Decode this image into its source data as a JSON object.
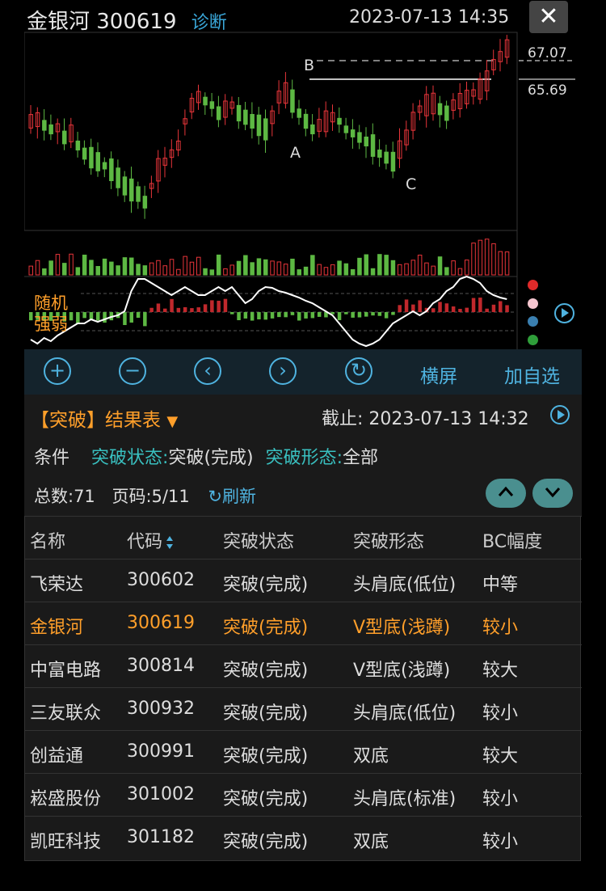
{
  "header": {
    "title": "金银河 300619",
    "diagnose_label": "诊断",
    "datetime": "2023-07-13 14:35",
    "close_icon": "close-icon"
  },
  "price_labels": {
    "top": "67.07",
    "mid": "65.69"
  },
  "pattern_points": {
    "a": "A",
    "b": "B",
    "c": "C"
  },
  "indicator": {
    "label_line1": "随机",
    "label_line2": "强弱"
  },
  "colors": {
    "up": "#e8353a",
    "down": "#5db843",
    "accent": "#4fb3e0",
    "highlight": "#ff9f2a",
    "teal": "#39c0c0",
    "dots": [
      "#e02a2a",
      "#f5c6d0",
      "#3a7fb0",
      "#2f9e3a"
    ]
  },
  "toolbar": {
    "zoom_in_icon": "plus-circle-icon",
    "zoom_out_icon": "minus-circle-icon",
    "prev_icon": "chevron-left-circle-icon",
    "next_icon": "chevron-right-circle-icon",
    "refresh_icon": "refresh-circle-icon",
    "landscape_label": "横屏",
    "add_watch_label": "加自选"
  },
  "result": {
    "title": "【突破】结果表",
    "cutoff": "截止: 2023-07-13 14:32",
    "condition_label": "条件",
    "cond1_key": "突破状态:",
    "cond1_val": "突破(完成)",
    "cond2_key": "突破形态:",
    "cond2_val": "全部",
    "total": "总数:71",
    "page": "页码:5/11",
    "refresh_label": "刷新"
  },
  "table": {
    "headers": [
      "名称",
      "代码",
      "突破状态",
      "突破形态",
      "BC幅度"
    ],
    "rows": [
      [
        "飞荣达",
        "300602",
        "突破(完成)",
        "头肩底(低位)",
        "中等"
      ],
      [
        "金银河",
        "300619",
        "突破(完成)",
        "V型底(浅蹲)",
        "较小"
      ],
      [
        "中富电路",
        "300814",
        "突破(完成)",
        "V型底(浅蹲)",
        "较大"
      ],
      [
        "三友联众",
        "300932",
        "突破(完成)",
        "头肩底(低位)",
        "较小"
      ],
      [
        "创益通",
        "300991",
        "突破(完成)",
        "双底",
        "较大"
      ],
      [
        "崧盛股份",
        "301002",
        "突破(完成)",
        "头肩底(标准)",
        "较小"
      ],
      [
        "凯旺科技",
        "301182",
        "突破(完成)",
        "双底",
        "较小"
      ]
    ],
    "highlight_row": 1
  }
}
